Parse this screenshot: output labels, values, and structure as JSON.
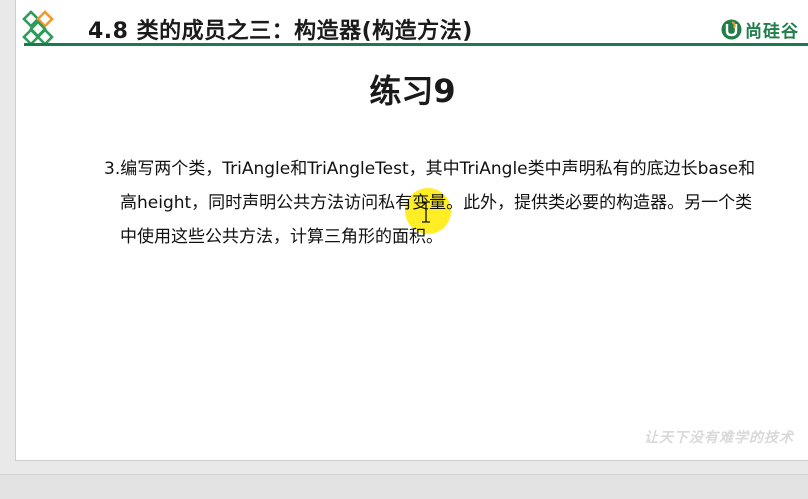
{
  "header": {
    "title": "4.8  类的成员之三：构造器(构造方法)",
    "brand_name": "尚硅谷"
  },
  "slide": {
    "heading": "练习9",
    "problem": "3.编写两个类，TriAngle和TriAngleTest，其中TriAngle类中声明私有的底边长base和高height，同时声明公共方法访问私有变量。此外，提供类必要的构造器。另一个类中使用这些公共方法，计算三角形的面积。",
    "slogan": "让天下没有难学的技术"
  },
  "colors": {
    "header_rule": "#1b7a4e",
    "brand": "#1f7e4a",
    "logo_diamond_green": "#2e9b5c",
    "logo_diamond_orange": "#f29a2e",
    "cursor_highlight": "#ffeb00"
  },
  "icons": {
    "logo": "diamond-grid-icon",
    "brand": "u-leaf-icon",
    "cursor": "text-cursor-icon"
  }
}
